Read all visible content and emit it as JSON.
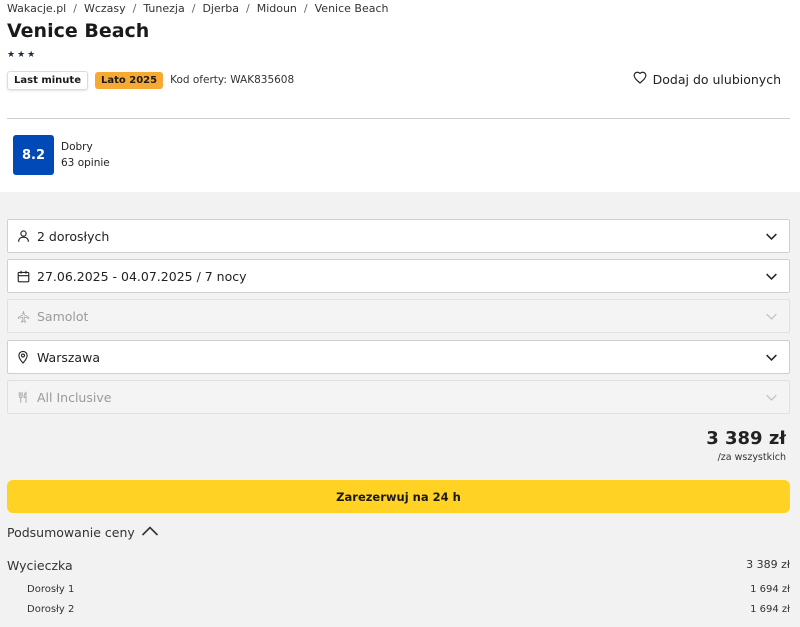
{
  "breadcrumb": [
    "Wakacje.pl",
    "Wczasy",
    "Tunezja",
    "Djerba",
    "Midoun",
    "Venice Beach"
  ],
  "hotel": {
    "title": "Venice Beach",
    "stars": 3,
    "stars_text": "★★★"
  },
  "badges": {
    "last_minute": "Last minute",
    "season": "Lato 2025",
    "offer_code": "Kod oferty: WAK835608"
  },
  "favorite_label": "Dodaj do ulubionych",
  "rating": {
    "score": "8.2",
    "label": "Dobry",
    "reviews": "63 opinie"
  },
  "booking": {
    "travelers": "2 dorosłych",
    "dates": "27.06.2025 - 04.07.2025 / 7 nocy",
    "transport": "Samolot",
    "departure": "Warszawa",
    "board": "All Inclusive"
  },
  "price": {
    "amount": "3 389 zł",
    "per": "/za wszystkich"
  },
  "book_button": "Zarezerwuj na 24 h",
  "summary": {
    "toggle_label": "Podsumowanie ceny",
    "trip_label": "Wycieczka",
    "trip_value": "3 389 zł",
    "lines": [
      {
        "label": "Dorosły 1",
        "value": "1 694 zł"
      },
      {
        "label": "Dorosły 2",
        "value": "1 694 zł"
      }
    ]
  },
  "colors": {
    "score_bg": "#0049b7",
    "season_badge": "#f7a934",
    "book_button": "#ffd223",
    "panel_bg": "#f2f2f2"
  }
}
